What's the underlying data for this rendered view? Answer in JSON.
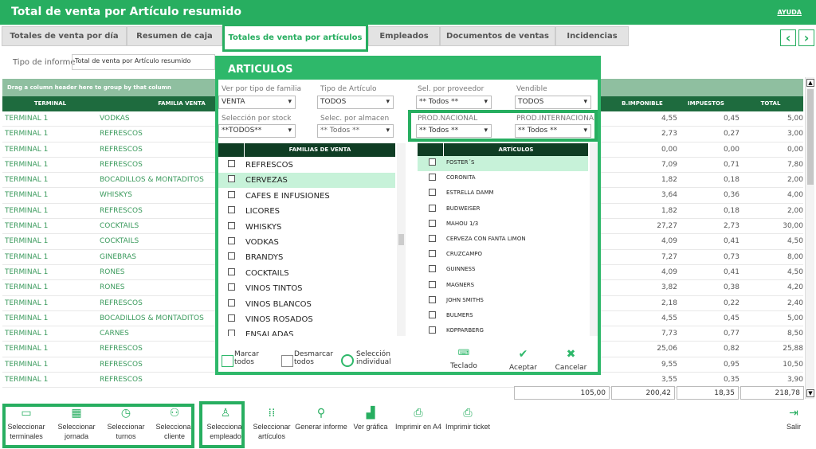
{
  "title": "Total de venta por Artículo resumido",
  "help_label": "AYUDA",
  "tabs": [
    "Totales de venta por día",
    "Resumen de caja",
    "Totales de venta por artículos",
    "Empleados",
    "Documentos de ventas",
    "Incidencias"
  ],
  "nav": {
    "prev": "‹",
    "next": "›"
  },
  "report_type": {
    "label": "Tipo de informe",
    "value": "Total de venta por Artículo resumido"
  },
  "drag_hint": "Drag a column header here to group by that column",
  "columns": [
    "TERMINAL",
    "FAMILIA VENTA",
    "B.IMPONIBLE",
    "IMPUESTOS",
    "TOTAL"
  ],
  "rows": [
    {
      "terminal": "TERMINAL 1",
      "familia": "VODKAS",
      "base": "4,55",
      "imp": "0,45",
      "total": "5,00"
    },
    {
      "terminal": "TERMINAL 1",
      "familia": "REFRESCOS",
      "base": "2,73",
      "imp": "0,27",
      "total": "3,00"
    },
    {
      "terminal": "TERMINAL 1",
      "familia": "REFRESCOS",
      "base": "0,00",
      "imp": "0,00",
      "total": "0,00"
    },
    {
      "terminal": "TERMINAL 1",
      "familia": "REFRESCOS",
      "base": "7,09",
      "imp": "0,71",
      "total": "7,80"
    },
    {
      "terminal": "TERMINAL 1",
      "familia": "BOCADILLOS & MONTADITOS",
      "base": "1,82",
      "imp": "0,18",
      "total": "2,00"
    },
    {
      "terminal": "TERMINAL 1",
      "familia": "WHISKYS",
      "base": "3,64",
      "imp": "0,36",
      "total": "4,00"
    },
    {
      "terminal": "TERMINAL 1",
      "familia": "REFRESCOS",
      "base": "1,82",
      "imp": "0,18",
      "total": "2,00"
    },
    {
      "terminal": "TERMINAL 1",
      "familia": "COCKTAILS",
      "base": "27,27",
      "imp": "2,73",
      "total": "30,00"
    },
    {
      "terminal": "TERMINAL 1",
      "familia": "COCKTAILS",
      "base": "4,09",
      "imp": "0,41",
      "total": "4,50"
    },
    {
      "terminal": "TERMINAL 1",
      "familia": "GINEBRAS",
      "base": "7,27",
      "imp": "0,73",
      "total": "8,00"
    },
    {
      "terminal": "TERMINAL 1",
      "familia": "RONES",
      "base": "4,09",
      "imp": "0,41",
      "total": "4,50"
    },
    {
      "terminal": "TERMINAL 1",
      "familia": "RONES",
      "base": "3,82",
      "imp": "0,38",
      "total": "4,20"
    },
    {
      "terminal": "TERMINAL 1",
      "familia": "REFRESCOS",
      "base": "2,18",
      "imp": "0,22",
      "total": "2,40"
    },
    {
      "terminal": "TERMINAL 1",
      "familia": "BOCADILLOS & MONTADITOS",
      "base": "4,55",
      "imp": "0,45",
      "total": "5,00"
    },
    {
      "terminal": "TERMINAL 1",
      "familia": "CARNES",
      "base": "7,73",
      "imp": "0,77",
      "total": "8,50"
    },
    {
      "terminal": "TERMINAL 1",
      "familia": "REFRESCOS",
      "base": "25,06",
      "imp": "0,82",
      "total": "25,88"
    },
    {
      "terminal": "TERMINAL 1",
      "familia": "REFRESCOS",
      "base": "9,55",
      "imp": "0,95",
      "total": "10,50"
    },
    {
      "terminal": "TERMINAL 1",
      "familia": "REFRESCOS",
      "base": "3,55",
      "imp": "0,35",
      "total": "3,90"
    }
  ],
  "totals": [
    "105,00",
    "200,42",
    "18,35",
    "218,78"
  ],
  "toolbar": [
    {
      "label": "Seleccionar terminales",
      "icon": "monitor-icon"
    },
    {
      "label": "Seleccionar jornada",
      "icon": "calendar-icon"
    },
    {
      "label": "Seleccionar turnos",
      "icon": "clock-icon"
    },
    {
      "label": "Seleccionar cliente",
      "icon": "add-user-icon"
    },
    {
      "label": "Seleccionar empleado",
      "icon": "user-icon"
    },
    {
      "label": "Seleccionar artículos",
      "icon": "grid-icon"
    },
    {
      "label": "Generar informe",
      "icon": "search-icon"
    },
    {
      "label": "Ver gráfica",
      "icon": "chart-icon"
    },
    {
      "label": "Imprimir en A4",
      "icon": "printer-icon"
    },
    {
      "label": "Imprimir ticket",
      "icon": "printer-icon"
    }
  ],
  "exit_label": "Salir",
  "dialog": {
    "title": "ARTICULOS",
    "filters": {
      "tipo_familia": {
        "label": "Ver por tipo de familia",
        "value": "VENTA"
      },
      "tipo_articulo": {
        "label": "Tipo de Artículo",
        "value": "TODOS"
      },
      "proveedor": {
        "label": "Sel. por proveedor",
        "value": "** Todos **"
      },
      "vendible": {
        "label": "Vendible",
        "value": "TODOS"
      },
      "stock": {
        "label": "Selección por stock",
        "value": "**TODOS**"
      },
      "almacen": {
        "label": "Selec. por almacen",
        "value": "** Todos **"
      },
      "nacional": {
        "label": "PROD.NACIONAL",
        "value": "** Todos **"
      },
      "internacional": {
        "label": "PROD.INTERNACIONAL",
        "value": "** Todos **"
      }
    },
    "familias_header": "FAMILIAS DE VENTA",
    "familias": [
      "REFRESCOS",
      "CERVEZAS",
      "CAFES E INFUSIONES",
      "LICORES",
      "WHISKYS",
      "VODKAS",
      "BRANDYS",
      "COCKTAILS",
      "VINOS TINTOS",
      "VINOS BLANCOS",
      "VINOS ROSADOS",
      "ENSALADAS"
    ],
    "articulos_header": "ARTÍCULOS",
    "articulos": [
      "FOSTER´S",
      "CORONITA",
      "ESTRELLA DAMM",
      "BUDWEISER",
      "MAHOU 1/3",
      "CERVEZA CON FANTA LIMON",
      "CRUZCAMPO",
      "GUINNESS",
      "MAGNERS",
      "JOHN SMITHS",
      "BULMERS",
      "KOPPARBERG"
    ],
    "marcar": "Marcar todos",
    "desmarcar": "Desmarcar todos",
    "individual": "Selección individual",
    "teclado": "Teclado",
    "aceptar": "Aceptar",
    "cancelar": "Cancelar"
  }
}
